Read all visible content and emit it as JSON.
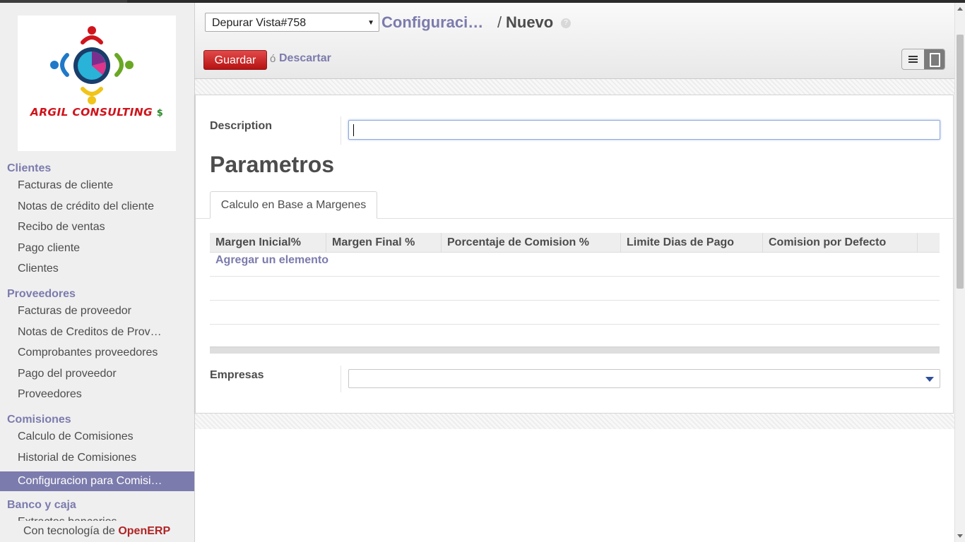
{
  "logo": {
    "company": "ARGIL CONSULTING",
    "symbol": "$"
  },
  "sidebar": {
    "sections": [
      {
        "title": "Clientes",
        "items": [
          "Facturas de cliente",
          "Notas de crédito del cliente",
          "Recibo de ventas",
          "Pago cliente",
          "Clientes"
        ]
      },
      {
        "title": "Proveedores",
        "items": [
          "Facturas de proveedor",
          "Notas de Creditos de Prov…",
          "Comprobantes proveedores",
          "Pago del proveedor",
          "Proveedores"
        ]
      },
      {
        "title": "Comisiones",
        "items": [
          "Calculo de Comisiones",
          "Historial de Comisiones",
          "Configuracion para Comisi…"
        ]
      },
      {
        "title": "Banco y caja",
        "items": [
          "Extractos bancarios"
        ]
      }
    ],
    "active_item": "Configuracion para Comisi…",
    "powered_by_prefix": "Con tecnología de",
    "powered_by_brand": "OpenERP"
  },
  "header": {
    "debug_select": "Depurar Vista#758",
    "breadcrumb_parent": "Configuraci…",
    "breadcrumb_separator": "/",
    "breadcrumb_current": "Nuevo",
    "help": "?",
    "save_label": "Guardar",
    "or_label": "ó",
    "discard_label": "Descartar"
  },
  "form": {
    "description_label": "Description",
    "description_value": "",
    "section_title": "Parametros",
    "tab_label": "Calculo en Base a Margenes",
    "columns": [
      "Margen Inicial%",
      "Margen Final %",
      "Porcentaje de Comision %",
      "Limite Dias de Pago",
      "Comision por Defecto"
    ],
    "add_item_label": "Agregar un elemento",
    "empresas_label": "Empresas",
    "empresas_value": ""
  },
  "colors": {
    "accent": "#7c7bad",
    "save": "#c81d1d",
    "brand_red": "#b02424"
  }
}
